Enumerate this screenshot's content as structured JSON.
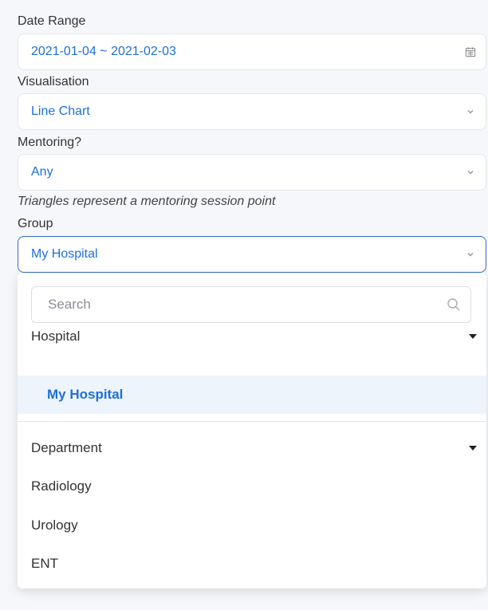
{
  "filters": {
    "date_range": {
      "label": "Date Range",
      "value": "2021-01-04 ~ 2021-02-03"
    },
    "visualisation": {
      "label": "Visualisation",
      "value": "Line Chart"
    },
    "mentoring": {
      "label": "Mentoring?",
      "value": "Any",
      "hint": "Triangles represent a mentoring session point"
    },
    "group": {
      "label": "Group",
      "value": "My Hospital"
    }
  },
  "dropdown": {
    "search_placeholder": "Search",
    "groups": [
      {
        "title": "Hospital",
        "options": [
          "My Hospital"
        ]
      },
      {
        "title": "Department",
        "options": [
          "Radiology",
          "Urology",
          "ENT"
        ]
      }
    ]
  },
  "colors": {
    "accent": "#1e6fd9",
    "selected_bg": "#eef4fb",
    "focus_border": "#2f6fc2"
  },
  "icons": {
    "date": "calendar-icon",
    "select": "chevron-down-icon",
    "search": "search-icon",
    "group": "caret-down-icon"
  }
}
